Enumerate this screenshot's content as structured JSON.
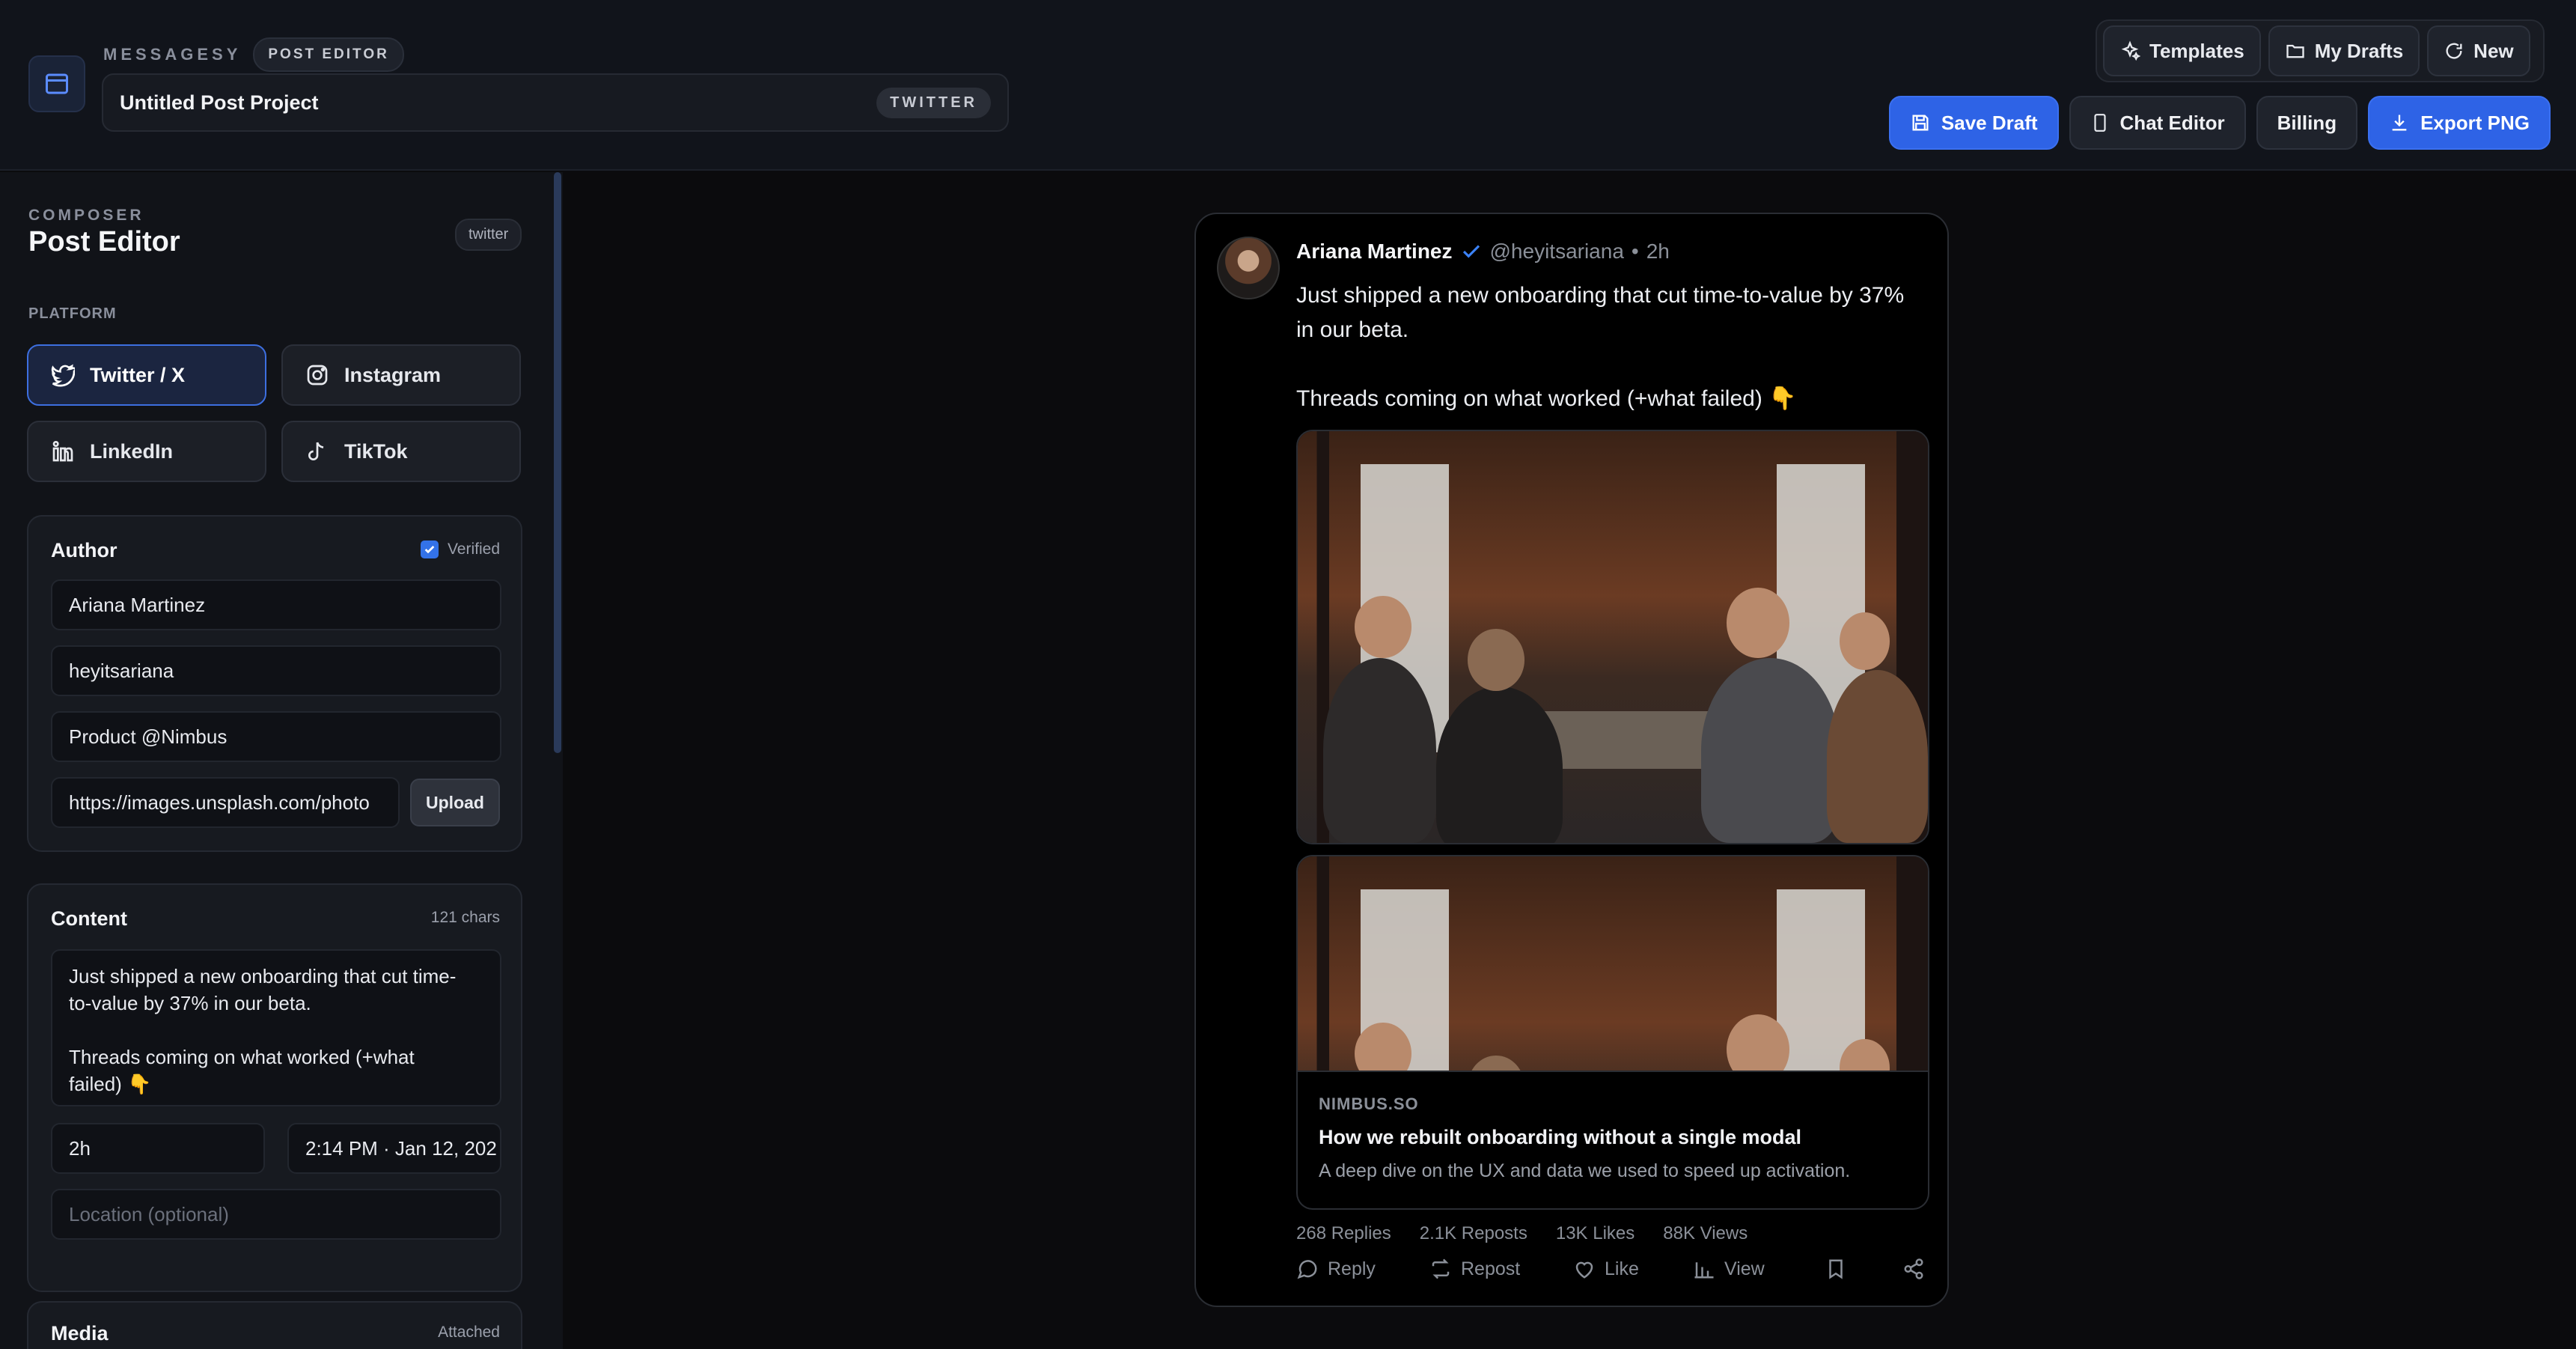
{
  "header": {
    "brand": "MESSAGESY",
    "mode_pill": "POST EDITOR",
    "project_name": "Untitled Post Project",
    "platform_pill": "TWITTER",
    "nav": {
      "templates": "Templates",
      "drafts": "My Drafts",
      "new": "New"
    },
    "actions": {
      "save": "Save Draft",
      "chat": "Chat Editor",
      "billing": "Billing",
      "export": "Export PNG"
    }
  },
  "sidebar": {
    "section": "COMPOSER",
    "title": "Post Editor",
    "tag": "twitter",
    "platform_label": "PLATFORM",
    "platforms": [
      {
        "label": "Twitter / X",
        "icon": "twitter-icon",
        "active": true
      },
      {
        "label": "Instagram",
        "icon": "instagram-icon",
        "active": false
      },
      {
        "label": "LinkedIn",
        "icon": "linkedin-icon",
        "active": false
      },
      {
        "label": "TikTok",
        "icon": "tiktok-icon",
        "active": false
      }
    ],
    "author": {
      "title": "Author",
      "verified_label": "Verified",
      "verified": true,
      "name": "Ariana Martinez",
      "handle": "heyitsariana",
      "bio": "Product @Nimbus",
      "avatar_url": "https://images.unsplash.com/photo",
      "upload_label": "Upload"
    },
    "content": {
      "title": "Content",
      "chars": "121 chars",
      "text": "Just shipped a new onboarding that cut time-\nto-value by 37% in our beta.\n\nThreads coming on what worked (+what\nfailed) 👇",
      "relative_time": "2h",
      "timestamp": "2:14 PM · Jan 12, 202",
      "location_placeholder": "Location (optional)"
    },
    "media": {
      "title": "Media",
      "status": "Attached"
    }
  },
  "preview": {
    "name": "Ariana Martinez",
    "handle": "@heyitsariana",
    "dot": "•",
    "time": "2h",
    "text": "Just shipped a new onboarding that cut time-to-value by 37%\nin our beta.\n\nThreads coming on what worked (+what failed) 👇",
    "link": {
      "domain": "NIMBUS.SO",
      "title": "How we rebuilt onboarding without a single modal",
      "description": "A deep dive on the UX and data we used to speed up activation."
    },
    "stats": {
      "replies": "268 Replies",
      "reposts": "2.1K Reposts",
      "likes": "13K Likes",
      "views": "88K Views"
    },
    "actions": {
      "reply": "Reply",
      "repost": "Repost",
      "like": "Like",
      "view": "View"
    }
  },
  "colors": {
    "accent": "#2e63e6",
    "verified": "#3b82f6",
    "background": "#0b0b0d"
  }
}
